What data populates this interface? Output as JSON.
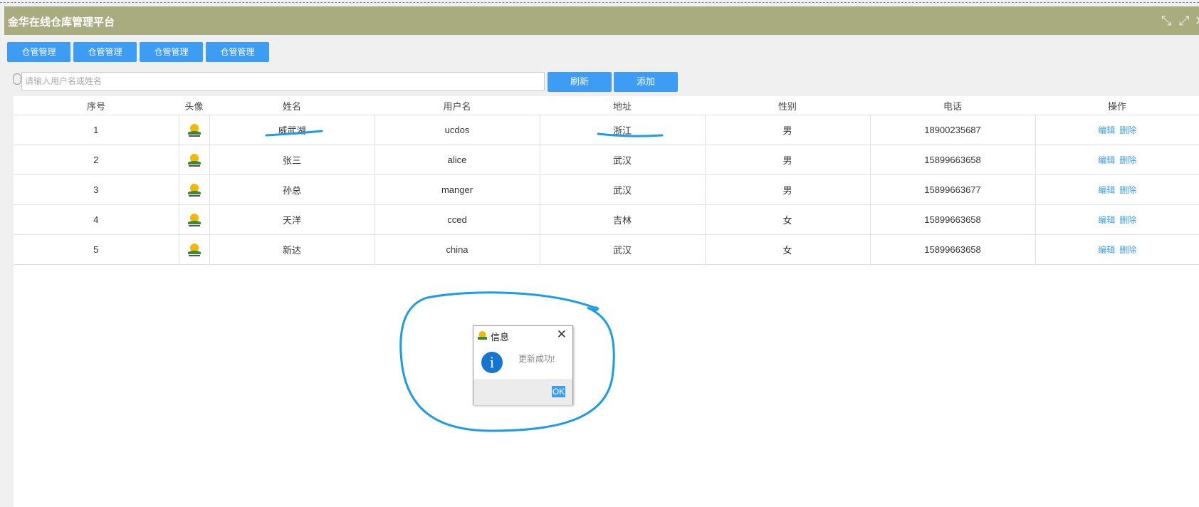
{
  "header": {
    "title": "金华在线仓库管理平台"
  },
  "nav": [
    {
      "label": "仓管管理"
    },
    {
      "label": "仓管管理"
    },
    {
      "label": "仓管管理"
    },
    {
      "label": "仓管管理"
    }
  ],
  "search": {
    "placeholder": "请输入用户名或姓名",
    "refresh_label": "刷新",
    "add_label": "添加"
  },
  "table": {
    "columns": [
      "序号",
      "头像",
      "姓名",
      "用户名",
      "地址",
      "性别",
      "电话",
      "操作"
    ],
    "rows": [
      {
        "no": "1",
        "name": "威武湖",
        "username": "ucdos",
        "address": "浙江",
        "gender": "男",
        "phone": "18900235687"
      },
      {
        "no": "2",
        "name": "张三",
        "username": "alice",
        "address": "武汉",
        "gender": "男",
        "phone": "15899663658"
      },
      {
        "no": "3",
        "name": "孙总",
        "username": "manger",
        "address": "武汉",
        "gender": "男",
        "phone": "15899663677"
      },
      {
        "no": "4",
        "name": "天洋",
        "username": "cced",
        "address": "吉林",
        "gender": "女",
        "phone": "15899663658"
      },
      {
        "no": "5",
        "name": "新达",
        "username": "china",
        "address": "武汉",
        "gender": "女",
        "phone": "15899663658"
      }
    ],
    "edit_label": "编辑",
    "delete_label": "删除"
  },
  "dialog": {
    "title": "信息",
    "message": "更新成功!",
    "ok_label": "OK",
    "close_label": "✕",
    "icon": "info-icon"
  },
  "colors": {
    "primary": "#3d9cf3",
    "titlebar": "#a9ac7e",
    "annotation": "#1c9be8"
  }
}
